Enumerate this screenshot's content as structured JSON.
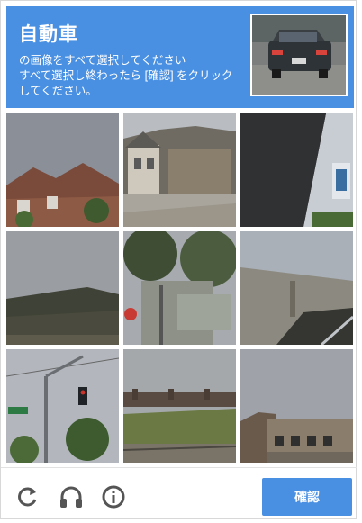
{
  "header": {
    "title": "自動車",
    "instruction_line1": "の画像をすべて選択してください",
    "instruction_line2": "すべて選択し終わったら [確認] をクリック",
    "instruction_line3": "してください。",
    "background_color": "#4a90e2"
  },
  "tiles": [
    {
      "index": 1,
      "content": "house with brick roof"
    },
    {
      "index": 2,
      "content": "suburban house"
    },
    {
      "index": 3,
      "content": "building wall and sign"
    },
    {
      "index": 4,
      "content": "roof and sky"
    },
    {
      "index": 5,
      "content": "trees and stop sign"
    },
    {
      "index": 6,
      "content": "roof and pole"
    },
    {
      "index": 7,
      "content": "traffic light pole"
    },
    {
      "index": 8,
      "content": "bridge and trees"
    },
    {
      "index": 9,
      "content": "shopping building"
    }
  ],
  "footer": {
    "reload_icon": "reload-icon",
    "audio_icon": "headphones-icon",
    "info_icon": "info-icon",
    "verify_label": "確認",
    "accent_color": "#4a90e2"
  }
}
